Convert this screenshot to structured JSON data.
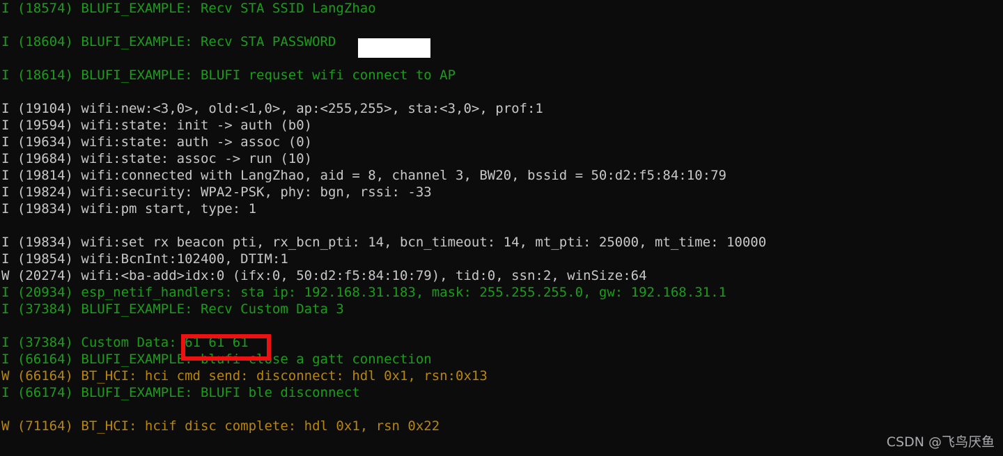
{
  "terminal": {
    "background_color": "#0c0c0c",
    "colors": {
      "info_green": "#1a9e1a",
      "plain_white": "#c8c8c8",
      "warn_yellow": "#b8860b",
      "highlight_red": "#ee1111",
      "redaction_white": "#ffffff",
      "watermark_grey": "#b9b9bd"
    },
    "lines": [
      {
        "text": "I (18574) BLUFI_EXAMPLE: Recv STA SSID LangZhao",
        "level": "I",
        "color": "green"
      },
      {
        "text": "",
        "level": "",
        "color": "green"
      },
      {
        "text": "I (18604) BLUFI_EXAMPLE: Recv STA PASSWORD",
        "level": "I",
        "color": "green"
      },
      {
        "text": "",
        "level": "",
        "color": "green"
      },
      {
        "text": "I (18614) BLUFI_EXAMPLE: BLUFI requset wifi connect to AP",
        "level": "I",
        "color": "green"
      },
      {
        "text": "",
        "level": "",
        "color": "green"
      },
      {
        "text": "I (19104) wifi:new:<3,0>, old:<1,0>, ap:<255,255>, sta:<3,0>, prof:1",
        "level": "I",
        "color": "white"
      },
      {
        "text": "I (19594) wifi:state: init -> auth (b0)",
        "level": "I",
        "color": "white"
      },
      {
        "text": "I (19634) wifi:state: auth -> assoc (0)",
        "level": "I",
        "color": "white"
      },
      {
        "text": "I (19684) wifi:state: assoc -> run (10)",
        "level": "I",
        "color": "white"
      },
      {
        "text": "I (19814) wifi:connected with LangZhao, aid = 8, channel 3, BW20, bssid = 50:d2:f5:84:10:79",
        "level": "I",
        "color": "white"
      },
      {
        "text": "I (19824) wifi:security: WPA2-PSK, phy: bgn, rssi: -33",
        "level": "I",
        "color": "white"
      },
      {
        "text": "I (19834) wifi:pm start, type: 1",
        "level": "I",
        "color": "white"
      },
      {
        "text": "",
        "level": "",
        "color": "white"
      },
      {
        "text": "I (19834) wifi:set rx beacon pti, rx_bcn_pti: 14, bcn_timeout: 14, mt_pti: 25000, mt_time: 10000",
        "level": "I",
        "color": "white"
      },
      {
        "text": "I (19854) wifi:BcnInt:102400, DTIM:1",
        "level": "I",
        "color": "white"
      },
      {
        "text": "W (20274) wifi:<ba-add>idx:0 (ifx:0, 50:d2:f5:84:10:79), tid:0, ssn:2, winSize:64",
        "level": "W",
        "color": "white"
      },
      {
        "text": "I (20934) esp_netif_handlers: sta ip: 192.168.31.183, mask: 255.255.255.0, gw: 192.168.31.1",
        "level": "I",
        "color": "green"
      },
      {
        "text": "I (37384) BLUFI_EXAMPLE: Recv Custom Data 3",
        "level": "I",
        "color": "green"
      },
      {
        "text": "",
        "level": "",
        "color": "green"
      },
      {
        "text": "I (37384) Custom Data: 61 61 61",
        "level": "I",
        "color": "green"
      },
      {
        "text": "I (66164) BLUFI_EXAMPLE: blufi close a gatt connection",
        "level": "I",
        "color": "green"
      },
      {
        "text": "W (66164) BT_HCI: hci cmd send: disconnect: hdl 0x1, rsn:0x13",
        "level": "W",
        "color": "yellow"
      },
      {
        "text": "I (66174) BLUFI_EXAMPLE: BLUFI ble disconnect",
        "level": "I",
        "color": "green"
      },
      {
        "text": "",
        "level": "",
        "color": "green"
      },
      {
        "text": "W (71164) BT_HCI: hcif disc complete: hdl 0x1, rsn 0x22",
        "level": "W",
        "color": "yellow"
      }
    ]
  },
  "annotations": {
    "password_redaction": {
      "label": "redacted-password",
      "covers_text": "Recv STA PASSWORD"
    },
    "custom_data_highlight": {
      "label": "custom-data-bytes",
      "value": "61 61 61"
    }
  },
  "watermark": {
    "text": "CSDN @飞鸟厌鱼"
  }
}
